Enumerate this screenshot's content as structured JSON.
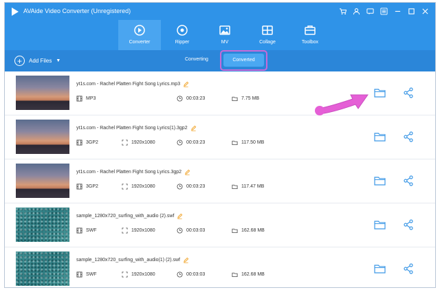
{
  "window": {
    "title": "AVAide Video Converter (Unregistered)"
  },
  "nav": {
    "tabs": [
      {
        "label": "Converter",
        "icon": "converter-icon",
        "active": true
      },
      {
        "label": "Ripper",
        "icon": "ripper-icon",
        "active": false
      },
      {
        "label": "MV",
        "icon": "mv-icon",
        "active": false
      },
      {
        "label": "Collage",
        "icon": "collage-icon",
        "active": false
      },
      {
        "label": "Toolbox",
        "icon": "toolbox-icon",
        "active": false
      }
    ]
  },
  "toolbar": {
    "add_files_label": "Add Files",
    "segments": {
      "converting": "Converting",
      "converted": "Converted"
    }
  },
  "files": [
    {
      "name": "yt1s.com - Rachel Platten  Fight Song Lyrics.mp3",
      "format": "MP3",
      "resolution": "",
      "duration": "00:03:23",
      "size": "7.75 MB",
      "thumb": "sunset"
    },
    {
      "name": "yt1s.com - Rachel Platten  Fight Song Lyrics(1).3gp2",
      "format": "3GP2",
      "resolution": "1920x1080",
      "duration": "00:03:23",
      "size": "117.50 MB",
      "thumb": "sunset"
    },
    {
      "name": "yt1s.com - Rachel Platten  Fight Song Lyrics.3gp2",
      "format": "3GP2",
      "resolution": "1920x1080",
      "duration": "00:03:23",
      "size": "117.47 MB",
      "thumb": "sunset"
    },
    {
      "name": "sample_1280x720_surfing_with_audio (2).swf",
      "format": "SWF",
      "resolution": "1920x1080",
      "duration": "00:03:03",
      "size": "162.68 MB",
      "thumb": "sea"
    },
    {
      "name": "sample_1280x720_surfing_with_audio(1) (2).swf",
      "format": "SWF",
      "resolution": "1920x1080",
      "duration": "00:03:03",
      "size": "162.68 MB",
      "thumb": "sea"
    }
  ],
  "colors": {
    "header": "#2f93e8",
    "subbar": "#2b86d9",
    "accent": "#2f93e8",
    "highlight": "#c86ad8",
    "pointer": "#e55fd6"
  }
}
